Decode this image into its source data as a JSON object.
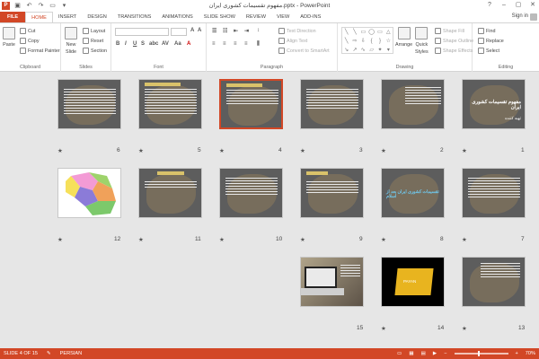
{
  "title": "مفهوم تقسیمات کشوری ایران.pptx - PowerPoint",
  "window": {
    "help": "?",
    "minimize": "–",
    "maximize": "▢",
    "close": "✕"
  },
  "tabs": [
    "FILE",
    "HOME",
    "INSERT",
    "DESIGN",
    "TRANSITIONS",
    "ANIMATIONS",
    "SLIDE SHOW",
    "REVIEW",
    "VIEW",
    "ADD-INS"
  ],
  "signin": "Sign in",
  "ribbon": {
    "clipboard": {
      "label": "Clipboard",
      "paste": "Paste",
      "cut": "Cut",
      "copy": "Copy",
      "format_painter": "Format Painter"
    },
    "slides": {
      "label": "Slides",
      "new_slide": "New",
      "new_slide2": "Slide",
      "layout": "Layout",
      "reset": "Reset",
      "section": "Section"
    },
    "font": {
      "label": "Font",
      "bold": "B",
      "italic": "I",
      "underline": "U",
      "strike": "S",
      "shadow": "abc",
      "spacing": "AV",
      "case": "Aa",
      "color": "A"
    },
    "paragraph": {
      "label": "Paragraph",
      "text_direction": "Text Direction",
      "align_text": "Align Text",
      "smartart": "Convert to SmartArt"
    },
    "drawing": {
      "label": "Drawing",
      "arrange": "Arrange",
      "quick_styles": "Quick",
      "quick_styles2": "Styles",
      "shape_fill": "Shape Fill",
      "shape_outline": "Shape Outline",
      "shape_effects": "Shape Effects"
    },
    "editing": {
      "label": "Editing",
      "find": "Find",
      "replace": "Replace",
      "select": "Select"
    }
  },
  "slides": [
    {
      "num": "1",
      "title": "مفهوم تقسیمات کشوری ایران",
      "subtitle": "تهیه کننده"
    },
    {
      "num": "2"
    },
    {
      "num": "3"
    },
    {
      "num": "4"
    },
    {
      "num": "5"
    },
    {
      "num": "6"
    },
    {
      "num": "7"
    },
    {
      "num": "8",
      "title": "تقسیمات کشوری ایران بعد از اسلام"
    },
    {
      "num": "9"
    },
    {
      "num": "10"
    },
    {
      "num": "11"
    },
    {
      "num": "12"
    },
    {
      "num": "13"
    },
    {
      "num": "14",
      "title": "PAYAN"
    },
    {
      "num": "15"
    }
  ],
  "status": {
    "slide": "SLIDE 4 OF 15",
    "language": "PERSIAN",
    "zoom": "70%"
  },
  "colors": {
    "accent": "#d24726",
    "selected_border": "#d24726"
  }
}
